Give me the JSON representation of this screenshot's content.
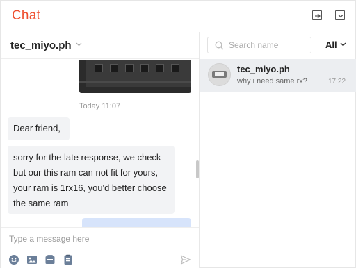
{
  "header": {
    "title": "Chat",
    "expand_icon": "expand-icon",
    "minimize_icon": "minimize-icon"
  },
  "conversation": {
    "name": "tec_miyo.ph",
    "timestamp": "Today 11:07",
    "messages": [
      {
        "from": "seller",
        "text": "Dear friend,"
      },
      {
        "from": "seller",
        "text": "sorry for the late response, we check but our this ram can not fit for yours, your ram is 1rx16, you'd better choose the same ram"
      }
    ]
  },
  "composer": {
    "placeholder": "Type a message here",
    "tools": [
      "emoji-icon",
      "image-icon",
      "product-icon",
      "order-icon"
    ],
    "send_icon": "send-icon"
  },
  "sidebar": {
    "search_placeholder": "Search name",
    "filter_label": "All",
    "conversations": [
      {
        "name": "tec_miyo.ph",
        "preview": "why i need same rx?",
        "time": "17:22"
      }
    ]
  },
  "colors": {
    "brand": "#ee4d2d",
    "own_bubble": "#d7e4fb",
    "other_bubble": "#f2f3f5",
    "selected_item": "#eceef1"
  }
}
